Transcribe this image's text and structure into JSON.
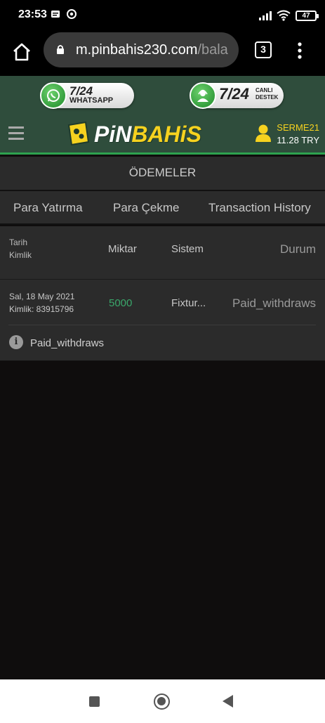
{
  "status_bar": {
    "time": "23:53",
    "battery": "47"
  },
  "browser": {
    "url_main": "m.pinbahis230.com",
    "url_rest": "/bala",
    "tab_count": "3"
  },
  "header": {
    "whatsapp_line1": "7/24",
    "whatsapp_line2": "WHATSAPP",
    "support_line1": "7/24",
    "support_line2": "CANLI",
    "support_line3": "DESTEK",
    "logo_part1": "PiN",
    "logo_part2": "BAHiS",
    "username": "SERME21",
    "balance": "11.28 TRY"
  },
  "page": {
    "title": "ÖDEMELER",
    "tabs": [
      "Para Yatırma",
      "Para Çekme",
      "Transaction History"
    ]
  },
  "table": {
    "headers": {
      "date": "Tarih",
      "id": "Kimlik",
      "amount": "Miktar",
      "system": "Sistem",
      "status": "Durum"
    },
    "rows": [
      {
        "date": "Sal, 18 May 2021",
        "id": "Kimlik: 83915796",
        "amount": "5000",
        "system": "Fixtur...",
        "status": "Paid_withdraws"
      }
    ],
    "info": "Paid_withdraws"
  },
  "colors": {
    "header_bg": "#2f4d3c",
    "accent_green": "#2ea24f",
    "logo_yellow": "#f6d21f",
    "amount_green": "#3aa66a"
  }
}
